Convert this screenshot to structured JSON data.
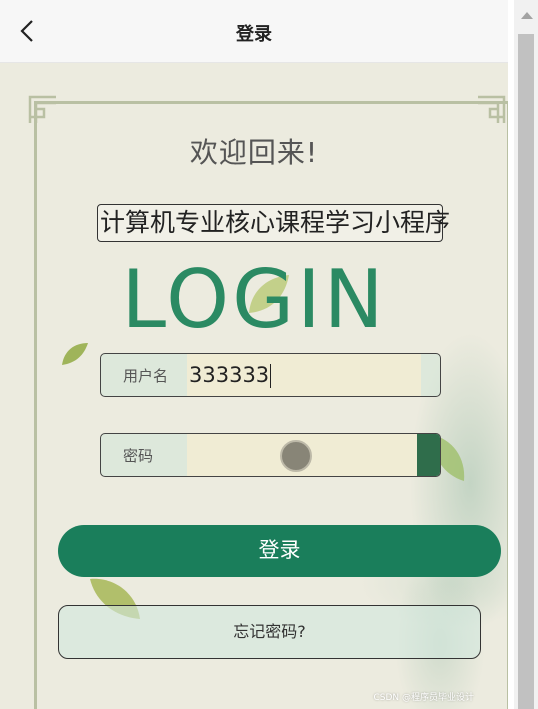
{
  "header": {
    "title": "登录",
    "back_icon": "chevron-left-icon"
  },
  "login": {
    "welcome": "欢迎回来!",
    "app_name": "计算机专业核心课程学习小程序",
    "big_title": "LOGIN",
    "username_label": "用户名",
    "username_value": "333333",
    "password_label": "密码",
    "password_value": "",
    "submit_label": "登录",
    "forgot_label": "忘记密码?"
  },
  "watermark": "CSDN @程序员毕业设计",
  "colors": {
    "brand_green": "#1a7e5b",
    "title_green": "#2b8a63",
    "paper_bg": "#ecebdf",
    "input_bg": "#f0ecd4"
  }
}
